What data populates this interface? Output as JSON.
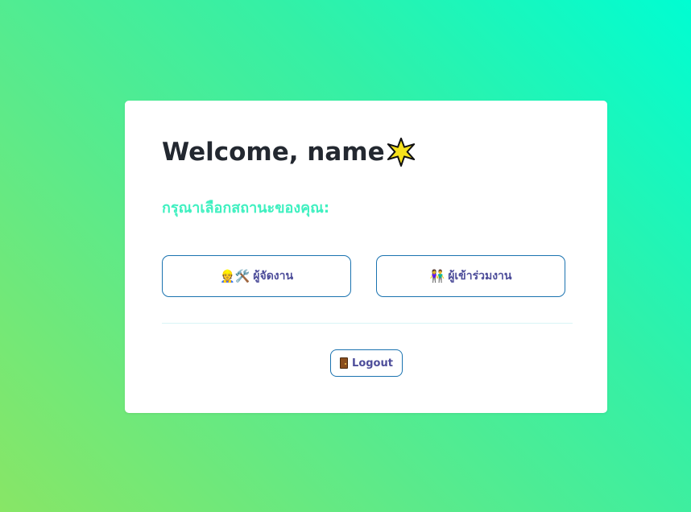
{
  "card": {
    "title": "Welcome, name",
    "title_emoji": "sparkle-star-icon",
    "prompt": "กรุณาเลือกสถานะของคุณ:"
  },
  "roles": [
    {
      "label": "ผู้จัดงาน",
      "icon": "organizer-icon",
      "emoji": "👷🛠️"
    },
    {
      "label": "ผู้เข้าร่วมงาน",
      "icon": "participants-icon",
      "emoji": "👫"
    }
  ],
  "logout": {
    "label": "Logout",
    "icon": "door-icon"
  },
  "colors": {
    "prompt": "#3ff0c0",
    "button_border": "#1a73b0",
    "button_text": "#4d4d9a",
    "title": "#232830"
  }
}
